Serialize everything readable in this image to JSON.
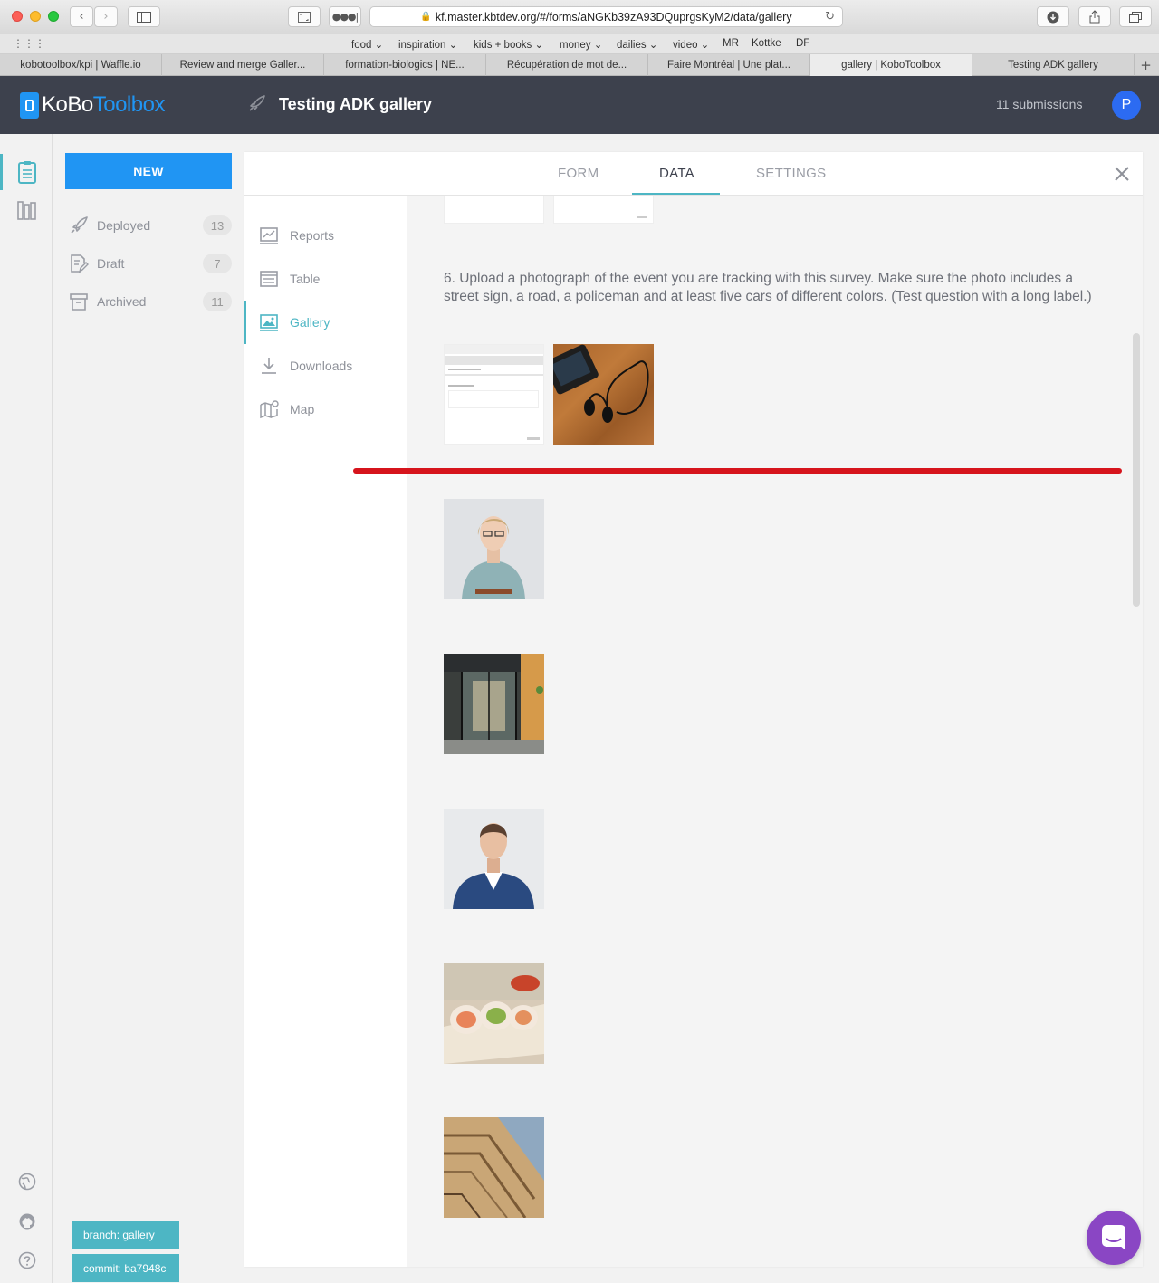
{
  "browser": {
    "url": "kf.master.kbtdev.org/#/forms/aNGKb39zA93DQuprgsKyM2/data/gallery",
    "favorites": [
      "food ⌄",
      "inspiration ⌄",
      "kids + books ⌄",
      "money ⌄",
      "dailies ⌄",
      "video ⌄",
      "MR",
      "Kottke",
      "DF"
    ],
    "tabs": [
      "kobotoolbox/kpi | Waffle.io",
      "Review and merge Galler...",
      "formation-biologics | NE...",
      "Récupération de mot de...",
      "Faire Montréal | Une plat...",
      "gallery | KoboToolbox",
      "Testing ADK gallery"
    ],
    "active_tab_index": 5
  },
  "header": {
    "logo_part1": "KoBo",
    "logo_part2": "Toolbox",
    "project_title": "Testing ADK gallery",
    "submissions": "11 submissions",
    "avatar_initial": "P",
    "brand_color": "#2095f3",
    "header_color": "#3d414d"
  },
  "sidebar": {
    "new_label": "NEW",
    "items": [
      {
        "label": "Deployed",
        "count": "13",
        "icon": "rocket-icon"
      },
      {
        "label": "Draft",
        "count": "7",
        "icon": "draft-icon"
      },
      {
        "label": "Archived",
        "count": "11",
        "icon": "archive-icon"
      }
    ],
    "branch": "branch: gallery",
    "commit": "commit: ba7948c"
  },
  "main_tabs": [
    {
      "label": "FORM"
    },
    {
      "label": "DATA",
      "active": true
    },
    {
      "label": "SETTINGS"
    }
  ],
  "subnav": [
    {
      "label": "Reports",
      "icon": "reports-icon"
    },
    {
      "label": "Table",
      "icon": "table-icon"
    },
    {
      "label": "Gallery",
      "icon": "gallery-icon",
      "active": true
    },
    {
      "label": "Downloads",
      "icon": "download-icon"
    },
    {
      "label": "Map",
      "icon": "map-icon"
    }
  ],
  "gallery": {
    "question": "6. Upload a photograph of the event you are tracking with this survey. Make sure the photo includes a street sign, a road, a policeman and at least five cars of different colors. (Test question with a long label.)"
  },
  "accent_color": "#4db6c4",
  "annotation_color": "#d6141c"
}
